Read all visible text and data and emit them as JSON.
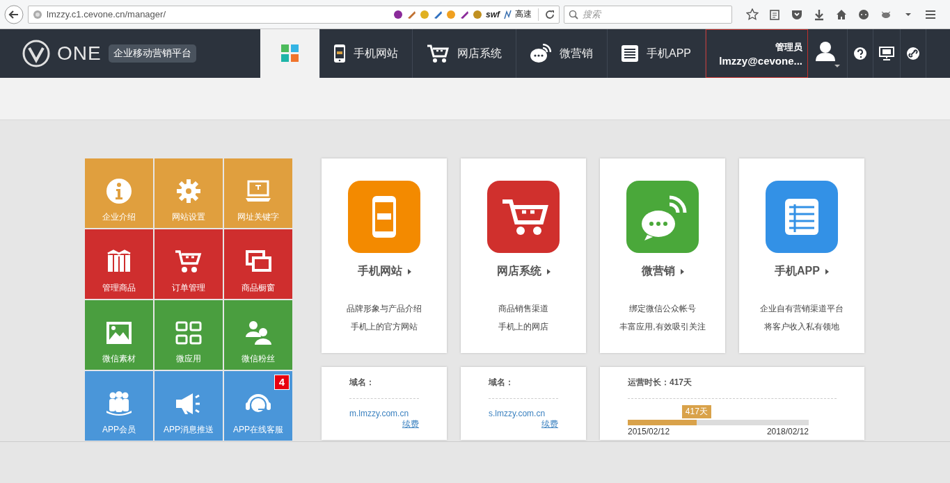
{
  "browser": {
    "url": "lmzzy.c1.cevone.cn/manager/",
    "extension_labels": [
      "swf",
      "高速"
    ],
    "search_placeholder": "搜索"
  },
  "header": {
    "logo": "ONE",
    "tagline": "企业移动营销平台",
    "nav": [
      {
        "kind": "dashboard",
        "selected": true
      },
      {
        "kind": "phone",
        "label": "手机网站",
        "selected": false
      },
      {
        "kind": "cart",
        "label": "网店系统",
        "selected": false
      },
      {
        "kind": "wechat",
        "label": "微营销",
        "selected": false
      },
      {
        "kind": "app",
        "label": "手机APP",
        "selected": false
      }
    ],
    "user": {
      "role": "管理员",
      "account": "lmzzy@cevone..."
    }
  },
  "tiles": [
    {
      "label": "企业介绍",
      "color": "#e09f3e"
    },
    {
      "label": "网站设置",
      "color": "#e09f3e"
    },
    {
      "label": "网址关键字",
      "color": "#e09f3e"
    },
    {
      "label": "管理商品",
      "color": "#cf2e2e"
    },
    {
      "label": "订单管理",
      "color": "#cf2e2e"
    },
    {
      "label": "商品橱窗",
      "color": "#cf2e2e"
    },
    {
      "label": "微信素材",
      "color": "#4a9e3f"
    },
    {
      "label": "微应用",
      "color": "#4a9e3f"
    },
    {
      "label": "微信粉丝",
      "color": "#4a9e3f"
    },
    {
      "label": "APP会员",
      "color": "#4a96d9"
    },
    {
      "label": "APP消息推送",
      "color": "#4a96d9"
    },
    {
      "label": "APP在线客服",
      "color": "#4a96d9"
    }
  ],
  "last_tile_badge": "4",
  "products": [
    {
      "title": "手机网站",
      "color": "#f38a00",
      "lines": [
        "品牌形象与产品介绍",
        "手机上的官方网站"
      ]
    },
    {
      "title": "网店系统",
      "color": "#d0302d",
      "lines": [
        "商品销售渠道",
        "手机上的网店"
      ]
    },
    {
      "title": "微营销",
      "color": "#4aa83a",
      "lines": [
        "绑定微信公众帐号",
        "丰富应用,有效吸引关注"
      ]
    },
    {
      "title": "手机APP",
      "color": "#3391e6",
      "lines": [
        "企业自有营销渠道平台",
        "将客户收入私有领地"
      ]
    }
  ],
  "domains": [
    {
      "label": "域名：",
      "domain": "m.lmzzy.com.cn",
      "action": "续费"
    },
    {
      "label": "域名：",
      "domain": "s.lmzzy.com.cn",
      "action": "续费"
    }
  ],
  "runtime": {
    "label": "运营时长：417天",
    "tooltip": "417天",
    "level": 0.38,
    "start": "2015/02/12",
    "end": "2018/02/12"
  }
}
